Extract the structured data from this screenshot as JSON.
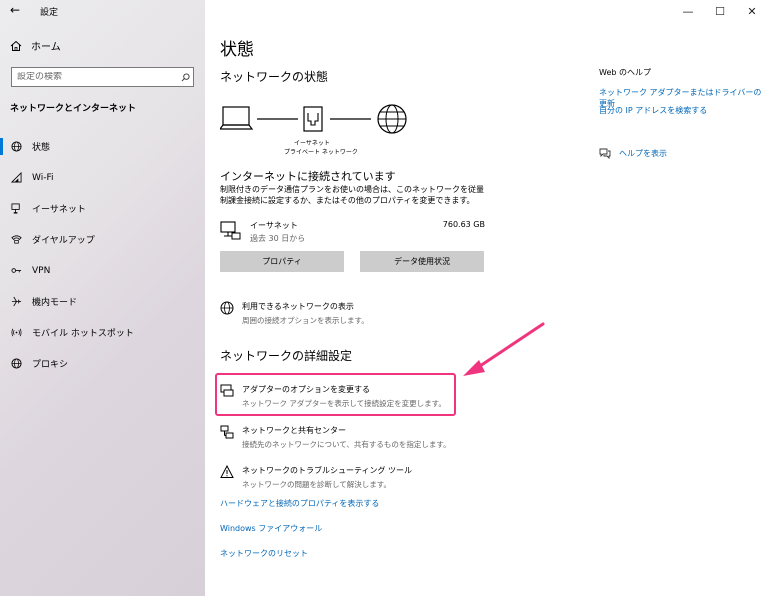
{
  "window": {
    "app_title": "設定",
    "minimize": "—",
    "maximize": "☐",
    "close": "✕"
  },
  "sidebar": {
    "home_label": "ホーム",
    "search_placeholder": "設定の検索",
    "section_title": "ネットワークとインターネット",
    "items": [
      {
        "label": "状態",
        "icon": "globe-status-icon",
        "active": true
      },
      {
        "label": "Wi-Fi",
        "icon": "wifi-icon"
      },
      {
        "label": "イーサネット",
        "icon": "ethernet-icon"
      },
      {
        "label": "ダイヤルアップ",
        "icon": "dialup-icon"
      },
      {
        "label": "VPN",
        "icon": "vpn-icon"
      },
      {
        "label": "機内モード",
        "icon": "airplane-icon"
      },
      {
        "label": "モバイル ホットスポット",
        "icon": "hotspot-icon"
      },
      {
        "label": "プロキシ",
        "icon": "globe-icon"
      }
    ]
  },
  "main": {
    "page_title": "状態",
    "network_status_title": "ネットワークの状態",
    "diagram": {
      "line1": "イーサネット",
      "line2": "プライベート ネットワーク"
    },
    "connection_status": "インターネットに接続されています",
    "connection_desc": "制限付きのデータ通信プランをお使いの場合は、このネットワークを従量制課金接続に設定するか、またはその他のプロパティを変更できます。",
    "ethernet": {
      "name": "イーサネット",
      "sub": "過去 30 日から",
      "size": "760.63 GB"
    },
    "buttons": {
      "properties": "プロパティ",
      "data_usage": "データ使用状況"
    },
    "available_networks": {
      "title": "利用できるネットワークの表示",
      "sub": "周囲の接続オプションを表示します。"
    },
    "advanced_title": "ネットワークの詳細設定",
    "adapter_options": {
      "title": "アダプターのオプションを変更する",
      "sub": "ネットワーク アダプターを表示して接続設定を変更します。"
    },
    "sharing_center": {
      "title": "ネットワークと共有センター",
      "sub": "接続先のネットワークについて、共有するものを指定します。"
    },
    "troubleshooter": {
      "title": "ネットワークのトラブルシューティング ツール",
      "sub": "ネットワークの問題を診断して解決します。"
    },
    "links": {
      "hardware": "ハードウェアと接続のプロパティを表示する",
      "firewall": "Windows ファイアウォール",
      "reset": "ネットワークのリセット"
    }
  },
  "right": {
    "title": "Web のヘルプ",
    "link1": "ネットワーク アダプターまたはドライバーの更新",
    "link2": "自分の IP アドレスを検索する",
    "help": "ヘルプを表示"
  },
  "colors": {
    "accent": "#0078d7",
    "link": "#0067b8",
    "highlight": "#f0347e"
  }
}
